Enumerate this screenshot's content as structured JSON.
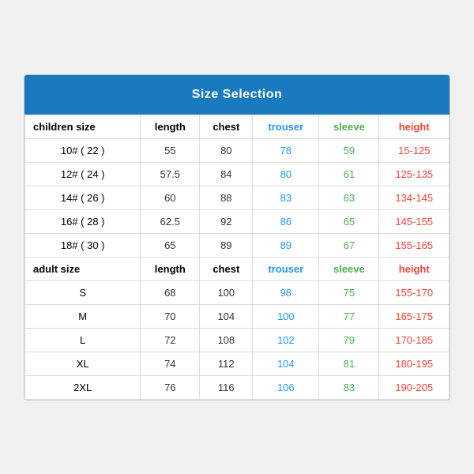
{
  "header": {
    "title": "Size Selection"
  },
  "columns": [
    "children size",
    "length",
    "chest",
    "trouser",
    "sleeve",
    "height"
  ],
  "children_rows": [
    {
      "size": "10# ( 22 )",
      "length": "55",
      "chest": "80",
      "trouser": "78",
      "sleeve": "59",
      "height": "15-125"
    },
    {
      "size": "12# ( 24 )",
      "length": "57.5",
      "chest": "84",
      "trouser": "80",
      "sleeve": "61",
      "height": "125-135"
    },
    {
      "size": "14# ( 26 )",
      "length": "60",
      "chest": "88",
      "trouser": "83",
      "sleeve": "63",
      "height": "134-145"
    },
    {
      "size": "16# ( 28 )",
      "length": "62.5",
      "chest": "92",
      "trouser": "86",
      "sleeve": "65",
      "height": "145-155"
    },
    {
      "size": "18# ( 30 )",
      "length": "65",
      "chest": "89",
      "trouser": "89",
      "sleeve": "67",
      "height": "155-165"
    }
  ],
  "adult_columns": [
    "adult size",
    "length",
    "chest",
    "trouser",
    "sleeve",
    "height"
  ],
  "adult_rows": [
    {
      "size": "S",
      "length": "68",
      "chest": "100",
      "trouser": "98",
      "sleeve": "75",
      "height": "155-170"
    },
    {
      "size": "M",
      "length": "70",
      "chest": "104",
      "trouser": "100",
      "sleeve": "77",
      "height": "165-175"
    },
    {
      "size": "L",
      "length": "72",
      "chest": "108",
      "trouser": "102",
      "sleeve": "79",
      "height": "170-185"
    },
    {
      "size": "XL",
      "length": "74",
      "chest": "112",
      "trouser": "104",
      "sleeve": "81",
      "height": "180-195"
    },
    {
      "size": "2XL",
      "length": "76",
      "chest": "116",
      "trouser": "106",
      "sleeve": "83",
      "height": "190-205"
    }
  ]
}
